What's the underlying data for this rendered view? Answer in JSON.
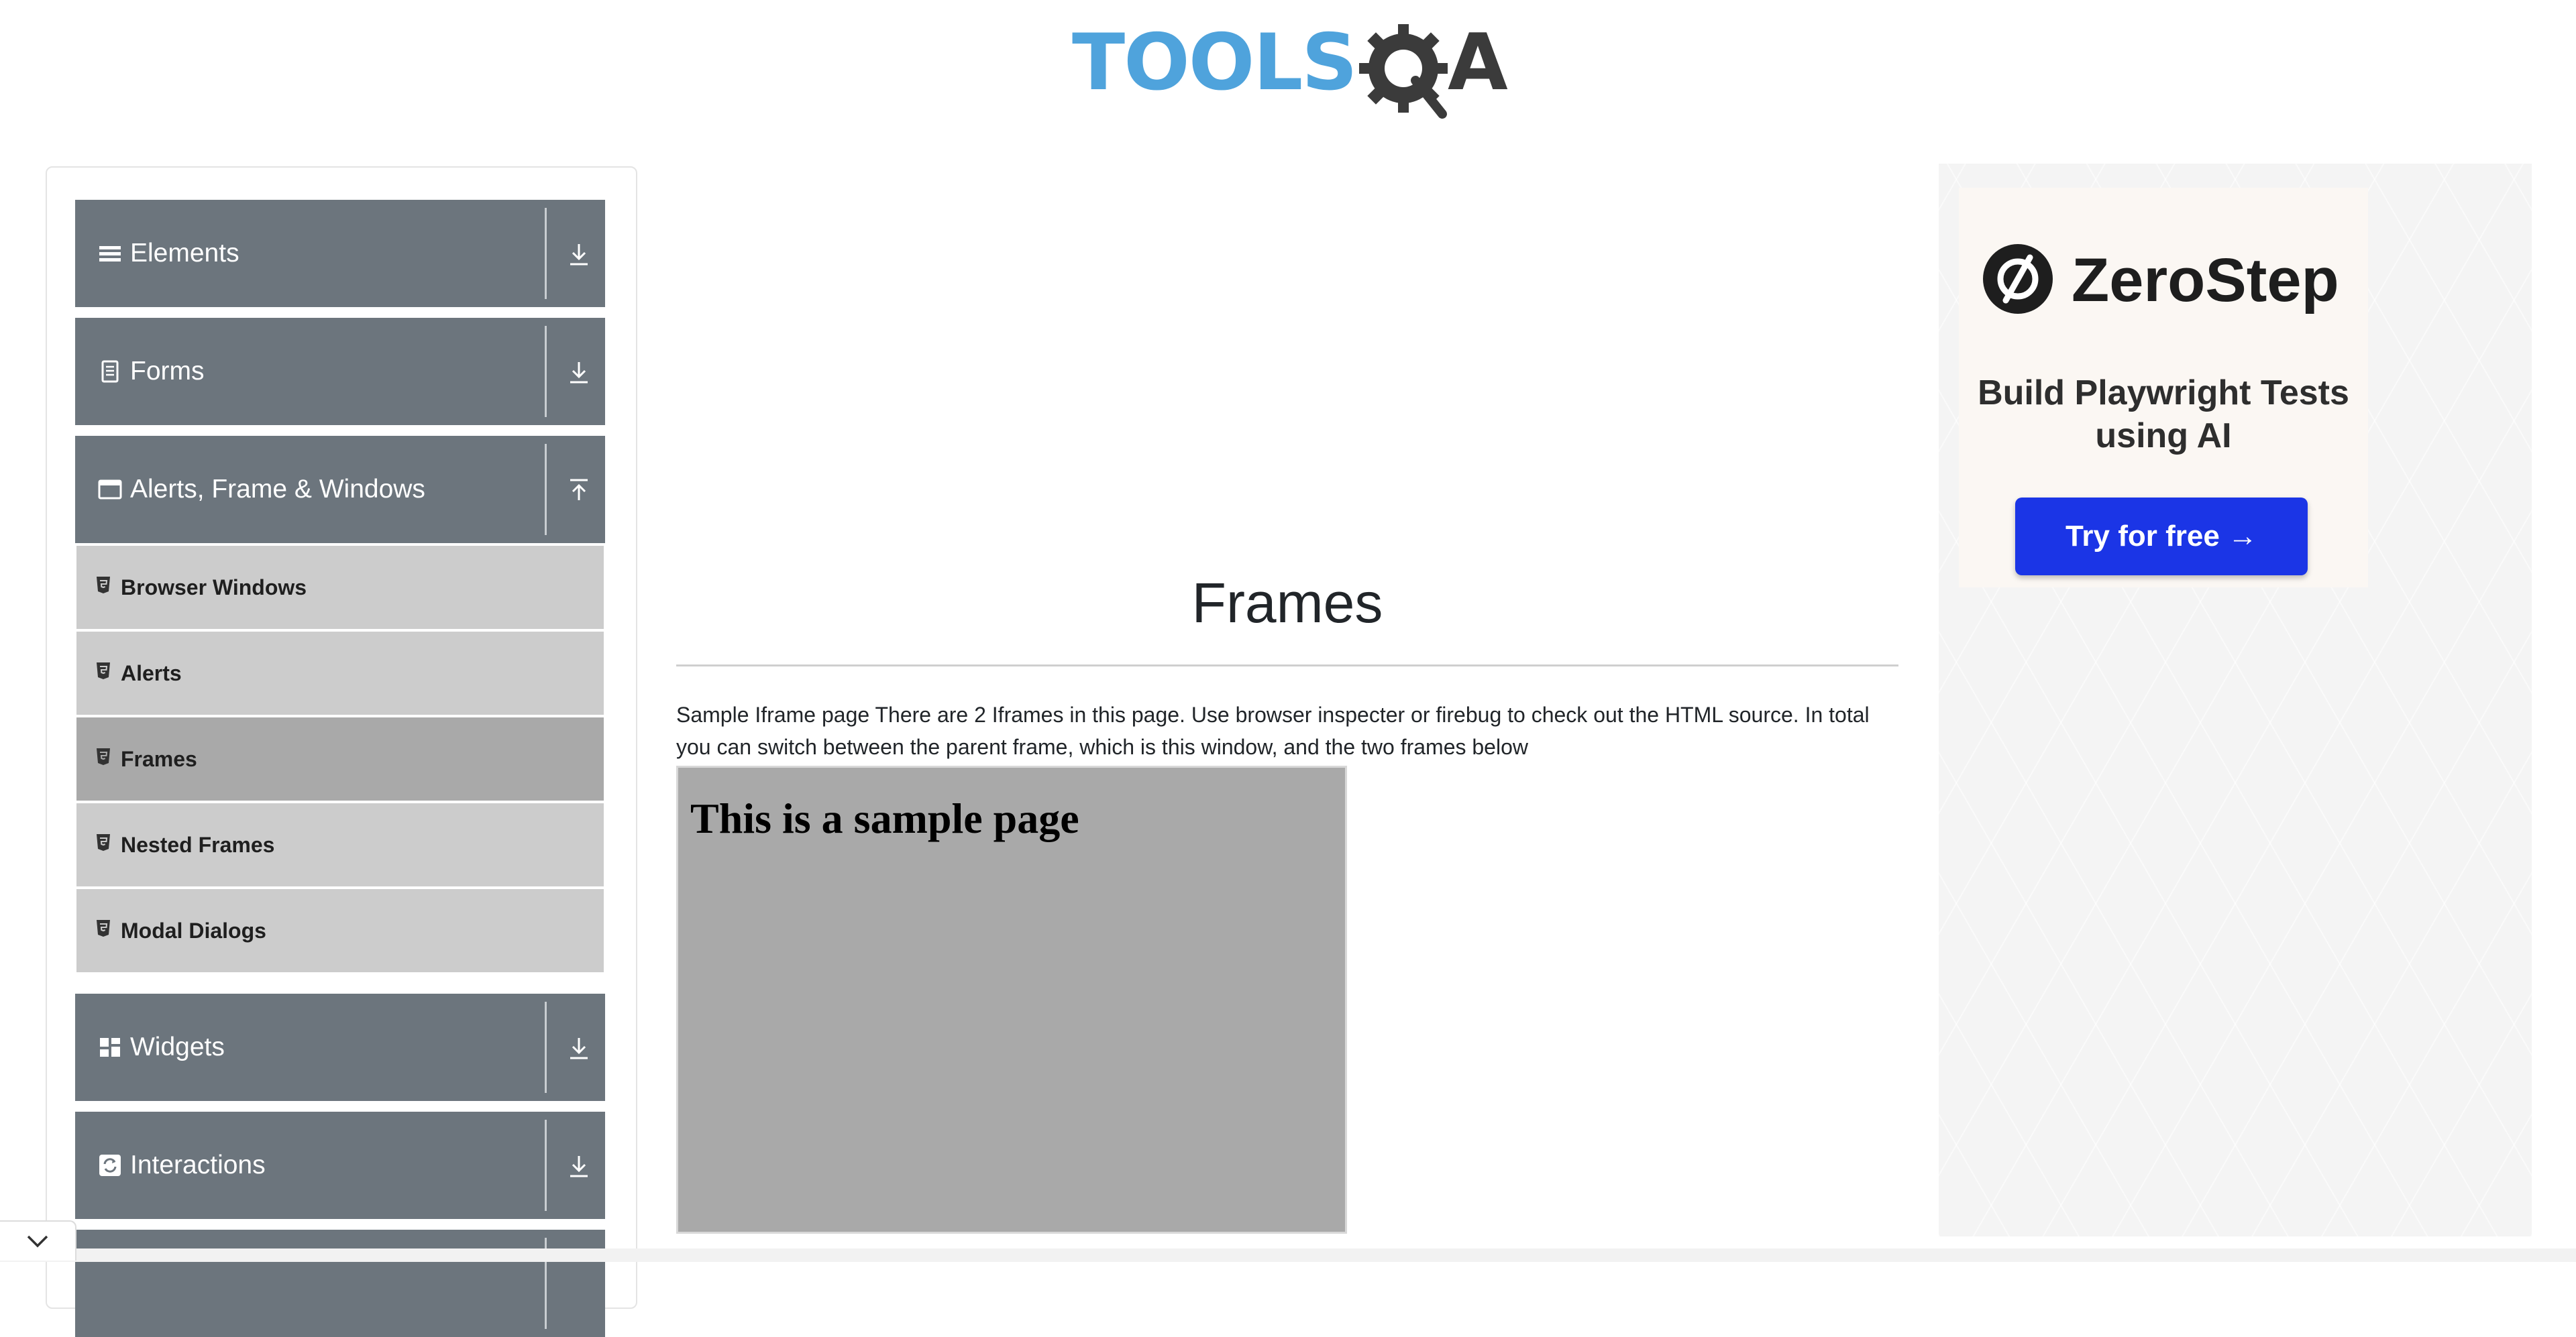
{
  "logo": {
    "text_part": "TOOLS",
    "letter_part": "A"
  },
  "sidebar": {
    "groups": [
      {
        "label": "Elements",
        "icon": "hamburger-icon",
        "expanded": false
      },
      {
        "label": "Forms",
        "icon": "document-icon",
        "expanded": false
      },
      {
        "label": "Alerts, Frame & Windows",
        "icon": "window-icon",
        "expanded": true
      },
      {
        "label": "Widgets",
        "icon": "grid-icon",
        "expanded": false
      },
      {
        "label": "Interactions",
        "icon": "refresh-icon",
        "expanded": false
      }
    ],
    "submenu": [
      {
        "label": "Browser Windows"
      },
      {
        "label": "Alerts"
      },
      {
        "label": "Frames",
        "active": true
      },
      {
        "label": "Nested Frames"
      },
      {
        "label": "Modal Dialogs"
      }
    ]
  },
  "main": {
    "title": "Frames",
    "description": "Sample Iframe page There are 2 Iframes in this page. Use browser inspecter or firebug to check out the HTML source. In total you can switch between the parent frame, which is this window, and the two frames below",
    "frame_heading": "This is a sample page"
  },
  "ad": {
    "brand": "ZeroStep",
    "tagline": "Build Playwright Tests using AI",
    "cta": "Try for free →",
    "colors": {
      "button": "#1b35e6",
      "card": "#fbf7f3"
    }
  },
  "colors": {
    "sidebar_group": "#6c757d",
    "submenu": "#cccccc",
    "submenu_active": "#a9a9a9",
    "logo_blue": "#4fa3dc"
  }
}
